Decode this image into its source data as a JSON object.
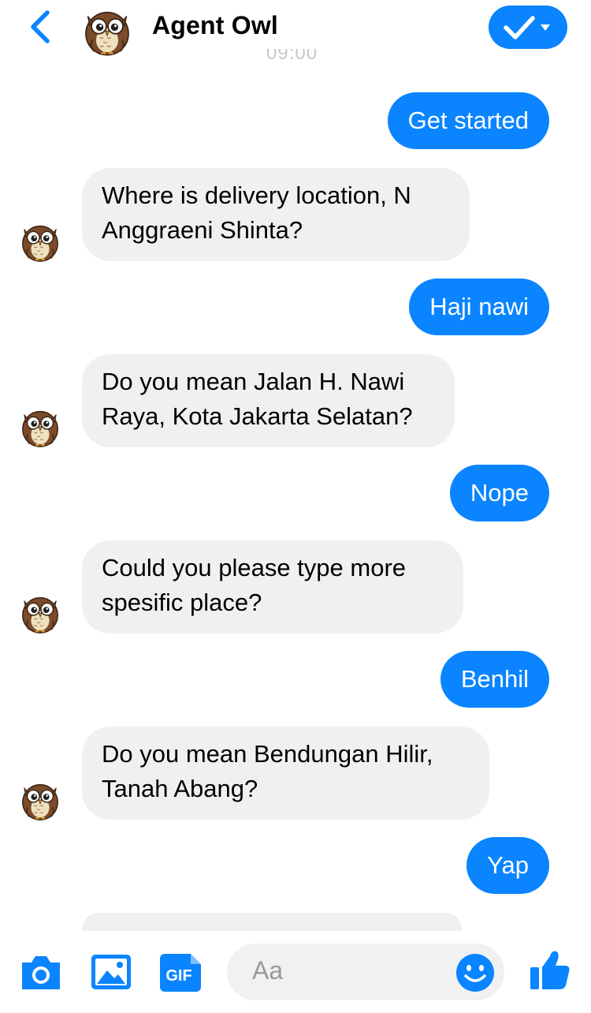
{
  "header": {
    "title": "Agent Owl",
    "faded_timestamp": "09:00",
    "back_icon": "chevron-left-icon",
    "status_icon": "checkmark-dropdown-icon",
    "accent_color": "#0a84ff"
  },
  "messages": [
    {
      "from": "user",
      "text": "Get started"
    },
    {
      "from": "bot",
      "line1": "Where is delivery location, N",
      "line2": "Anggraeni Shinta?"
    },
    {
      "from": "user",
      "text": "Haji nawi"
    },
    {
      "from": "bot",
      "line1": "Do you mean Jalan H. Nawi",
      "line2": "Raya, Kota Jakarta Selatan?"
    },
    {
      "from": "user",
      "text": "Nope"
    },
    {
      "from": "bot",
      "line1": "Could you please type more",
      "line2": "spesific place?"
    },
    {
      "from": "user",
      "text": "Benhil"
    },
    {
      "from": "bot",
      "line1": "Do you mean Bendungan Hilir,",
      "line2": "Tanah Abang?"
    },
    {
      "from": "user",
      "text": "Yap"
    }
  ],
  "composer": {
    "placeholder": "Aa",
    "gif_label": "GIF",
    "icons": [
      "camera-icon",
      "photo-icon",
      "gif-icon",
      "emoji-icon",
      "thumbs-up-icon"
    ]
  },
  "colors": {
    "outgoing_bubble": "#0a84ff",
    "incoming_bubble": "#f0f0f0",
    "owl_brown": "#7a4a2a"
  }
}
